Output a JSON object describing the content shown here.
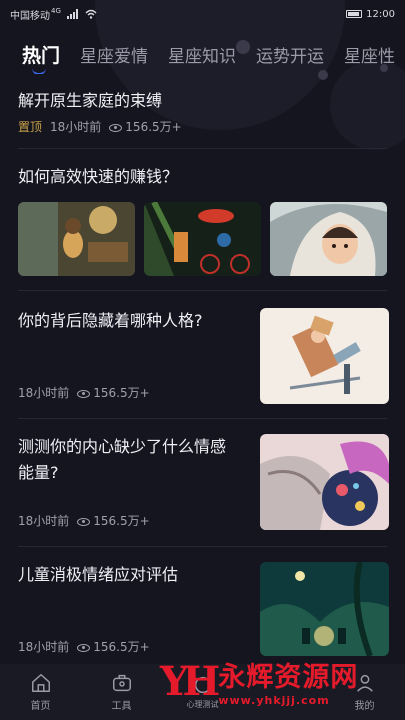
{
  "status_bar": {
    "carrier": "中国移动",
    "network": "4G",
    "time": "12:00"
  },
  "tabs": [
    {
      "label": "热门",
      "active": true
    },
    {
      "label": "星座爱情",
      "active": false
    },
    {
      "label": "星座知识",
      "active": false
    },
    {
      "label": "运势开运",
      "active": false
    },
    {
      "label": "星座性",
      "active": false
    }
  ],
  "feed": {
    "items": [
      {
        "title": "解开原生家庭的束缚",
        "pinned_label": "置顶",
        "time": "18小时前",
        "views": "156.5万+"
      },
      {
        "title": "如何高效快速的赚钱？"
      },
      {
        "title": "你的背后隐藏着哪种人格?",
        "time": "18小时前",
        "views": "156.5万+"
      },
      {
        "title": "测测你的内心缺少了什么情感能量?",
        "time": "18小时前",
        "views": "156.5万+"
      },
      {
        "title": "儿童消极情绪应对评估",
        "time": "18小时前",
        "views": "156.5万+"
      }
    ]
  },
  "bottom_nav": [
    {
      "label": "首页",
      "icon": "home-icon"
    },
    {
      "label": "工具",
      "icon": "toolbox-icon"
    },
    {
      "label": "心理测试",
      "icon": "test-icon"
    },
    {
      "label": "",
      "icon": "unknown"
    },
    {
      "label": "我的",
      "icon": "profile-icon"
    }
  ],
  "watermark": {
    "logo": "YH",
    "text": "永辉资源网",
    "url": "www.yhkjjj.com"
  }
}
